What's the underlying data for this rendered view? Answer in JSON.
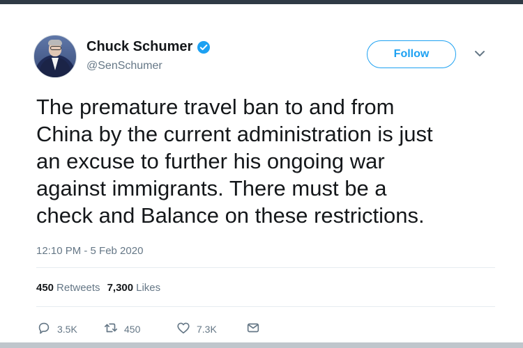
{
  "colors": {
    "accent": "#1da1f2",
    "text_primary": "#14171a",
    "text_secondary": "#657786",
    "divider": "#e6ecf0"
  },
  "author": {
    "display_name": "Chuck Schumer",
    "handle": "@SenSchumer",
    "verified_icon": "verified-badge-icon",
    "avatar": "avatar-photo"
  },
  "header": {
    "follow_label": "Follow",
    "more_icon": "chevron-down-icon"
  },
  "tweet": {
    "text": "The premature travel ban to and from\nChina by the current administration is just\nan excuse to further his ongoing war\nagainst immigrants. There must be a\ncheck and Balance on these restrictions.",
    "timestamp": "12:10 PM - 5 Feb 2020"
  },
  "stats": {
    "retweets_count": "450",
    "retweets_label": "Retweets",
    "likes_count": "7,300",
    "likes_label": "Likes"
  },
  "actions": {
    "reply": {
      "icon": "reply-icon",
      "count": "3.5K"
    },
    "retweet": {
      "icon": "retweet-icon",
      "count": "450"
    },
    "like": {
      "icon": "heart-icon",
      "count": "7.3K"
    },
    "message": {
      "icon": "message-icon"
    }
  }
}
